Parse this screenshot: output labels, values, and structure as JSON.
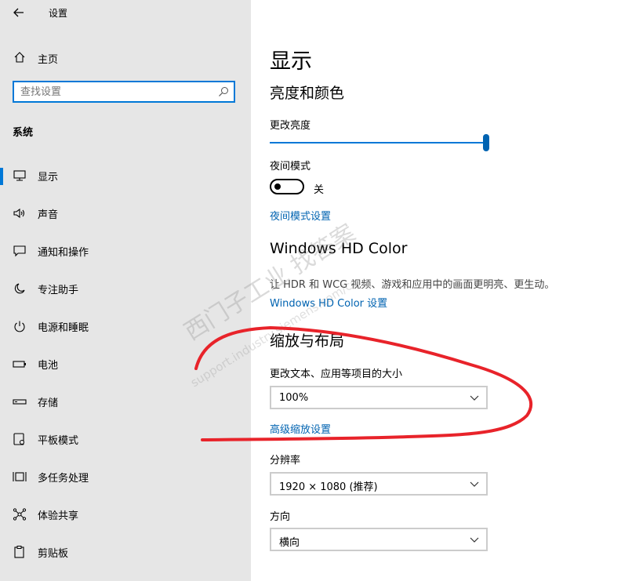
{
  "window": {
    "title": "设置"
  },
  "sidebar": {
    "home_label": "主页",
    "search_placeholder": "查找设置",
    "section_label": "系统",
    "items": [
      {
        "label": "显示",
        "icon": "monitor-icon",
        "active": true
      },
      {
        "label": "声音",
        "icon": "speaker-icon"
      },
      {
        "label": "通知和操作",
        "icon": "notification-icon"
      },
      {
        "label": "专注助手",
        "icon": "moon-icon"
      },
      {
        "label": "电源和睡眠",
        "icon": "power-icon"
      },
      {
        "label": "电池",
        "icon": "battery-icon"
      },
      {
        "label": "存储",
        "icon": "storage-icon"
      },
      {
        "label": "平板模式",
        "icon": "tablet-icon"
      },
      {
        "label": "多任务处理",
        "icon": "multitask-icon"
      },
      {
        "label": "体验共享",
        "icon": "share-icon"
      },
      {
        "label": "剪贴板",
        "icon": "clipboard-icon"
      }
    ]
  },
  "main": {
    "page_title": "显示",
    "brightness_section": {
      "title": "亮度和颜色",
      "brightness_label": "更改亮度",
      "brightness_value": 1.0,
      "night_mode_label": "夜间模式",
      "night_mode_state": "关",
      "night_mode_link": "夜间模式设置"
    },
    "hd_color": {
      "title": "Windows HD Color",
      "description": "让 HDR 和 WCG 视频、游戏和应用中的画面更明亮、更生动。",
      "link": "Windows HD Color 设置"
    },
    "scale_layout": {
      "title": "缩放与布局",
      "scale_label": "更改文本、应用等项目的大小",
      "scale_value": "100%",
      "advanced_link": "高级缩放设置",
      "resolution_label": "分辨率",
      "resolution_value": "1920 × 1080 (推荐)",
      "orientation_label": "方向",
      "orientation_value": "横向"
    }
  },
  "watermark": {
    "large": "西门子工业 找答案",
    "small": "support.industry.siemens.com/cs"
  },
  "colors": {
    "accent": "#0078d7",
    "link": "#0063b1",
    "annotation": "#e8232a",
    "sidebar_bg": "#e6e6e6"
  }
}
